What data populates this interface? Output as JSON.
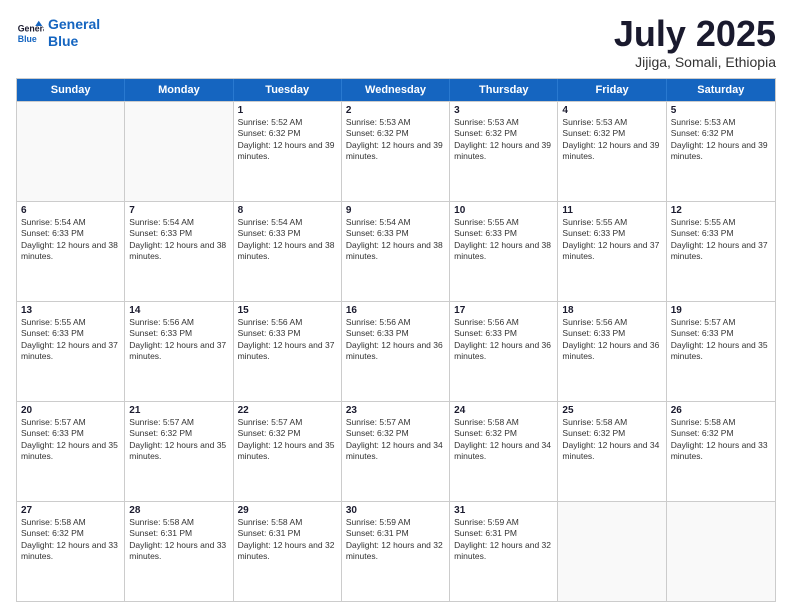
{
  "header": {
    "logo_line1": "General",
    "logo_line2": "Blue",
    "title": "July 2025",
    "location": "Jijiga, Somali, Ethiopia"
  },
  "days_of_week": [
    "Sunday",
    "Monday",
    "Tuesday",
    "Wednesday",
    "Thursday",
    "Friday",
    "Saturday"
  ],
  "weeks": [
    [
      {
        "day": "",
        "info": ""
      },
      {
        "day": "",
        "info": ""
      },
      {
        "day": "1",
        "info": "Sunrise: 5:52 AM\nSunset: 6:32 PM\nDaylight: 12 hours and 39 minutes."
      },
      {
        "day": "2",
        "info": "Sunrise: 5:53 AM\nSunset: 6:32 PM\nDaylight: 12 hours and 39 minutes."
      },
      {
        "day": "3",
        "info": "Sunrise: 5:53 AM\nSunset: 6:32 PM\nDaylight: 12 hours and 39 minutes."
      },
      {
        "day": "4",
        "info": "Sunrise: 5:53 AM\nSunset: 6:32 PM\nDaylight: 12 hours and 39 minutes."
      },
      {
        "day": "5",
        "info": "Sunrise: 5:53 AM\nSunset: 6:32 PM\nDaylight: 12 hours and 39 minutes."
      }
    ],
    [
      {
        "day": "6",
        "info": "Sunrise: 5:54 AM\nSunset: 6:33 PM\nDaylight: 12 hours and 38 minutes."
      },
      {
        "day": "7",
        "info": "Sunrise: 5:54 AM\nSunset: 6:33 PM\nDaylight: 12 hours and 38 minutes."
      },
      {
        "day": "8",
        "info": "Sunrise: 5:54 AM\nSunset: 6:33 PM\nDaylight: 12 hours and 38 minutes."
      },
      {
        "day": "9",
        "info": "Sunrise: 5:54 AM\nSunset: 6:33 PM\nDaylight: 12 hours and 38 minutes."
      },
      {
        "day": "10",
        "info": "Sunrise: 5:55 AM\nSunset: 6:33 PM\nDaylight: 12 hours and 38 minutes."
      },
      {
        "day": "11",
        "info": "Sunrise: 5:55 AM\nSunset: 6:33 PM\nDaylight: 12 hours and 37 minutes."
      },
      {
        "day": "12",
        "info": "Sunrise: 5:55 AM\nSunset: 6:33 PM\nDaylight: 12 hours and 37 minutes."
      }
    ],
    [
      {
        "day": "13",
        "info": "Sunrise: 5:55 AM\nSunset: 6:33 PM\nDaylight: 12 hours and 37 minutes."
      },
      {
        "day": "14",
        "info": "Sunrise: 5:56 AM\nSunset: 6:33 PM\nDaylight: 12 hours and 37 minutes."
      },
      {
        "day": "15",
        "info": "Sunrise: 5:56 AM\nSunset: 6:33 PM\nDaylight: 12 hours and 37 minutes."
      },
      {
        "day": "16",
        "info": "Sunrise: 5:56 AM\nSunset: 6:33 PM\nDaylight: 12 hours and 36 minutes."
      },
      {
        "day": "17",
        "info": "Sunrise: 5:56 AM\nSunset: 6:33 PM\nDaylight: 12 hours and 36 minutes."
      },
      {
        "day": "18",
        "info": "Sunrise: 5:56 AM\nSunset: 6:33 PM\nDaylight: 12 hours and 36 minutes."
      },
      {
        "day": "19",
        "info": "Sunrise: 5:57 AM\nSunset: 6:33 PM\nDaylight: 12 hours and 35 minutes."
      }
    ],
    [
      {
        "day": "20",
        "info": "Sunrise: 5:57 AM\nSunset: 6:33 PM\nDaylight: 12 hours and 35 minutes."
      },
      {
        "day": "21",
        "info": "Sunrise: 5:57 AM\nSunset: 6:32 PM\nDaylight: 12 hours and 35 minutes."
      },
      {
        "day": "22",
        "info": "Sunrise: 5:57 AM\nSunset: 6:32 PM\nDaylight: 12 hours and 35 minutes."
      },
      {
        "day": "23",
        "info": "Sunrise: 5:57 AM\nSunset: 6:32 PM\nDaylight: 12 hours and 34 minutes."
      },
      {
        "day": "24",
        "info": "Sunrise: 5:58 AM\nSunset: 6:32 PM\nDaylight: 12 hours and 34 minutes."
      },
      {
        "day": "25",
        "info": "Sunrise: 5:58 AM\nSunset: 6:32 PM\nDaylight: 12 hours and 34 minutes."
      },
      {
        "day": "26",
        "info": "Sunrise: 5:58 AM\nSunset: 6:32 PM\nDaylight: 12 hours and 33 minutes."
      }
    ],
    [
      {
        "day": "27",
        "info": "Sunrise: 5:58 AM\nSunset: 6:32 PM\nDaylight: 12 hours and 33 minutes."
      },
      {
        "day": "28",
        "info": "Sunrise: 5:58 AM\nSunset: 6:31 PM\nDaylight: 12 hours and 33 minutes."
      },
      {
        "day": "29",
        "info": "Sunrise: 5:58 AM\nSunset: 6:31 PM\nDaylight: 12 hours and 32 minutes."
      },
      {
        "day": "30",
        "info": "Sunrise: 5:59 AM\nSunset: 6:31 PM\nDaylight: 12 hours and 32 minutes."
      },
      {
        "day": "31",
        "info": "Sunrise: 5:59 AM\nSunset: 6:31 PM\nDaylight: 12 hours and 32 minutes."
      },
      {
        "day": "",
        "info": ""
      },
      {
        "day": "",
        "info": ""
      }
    ]
  ]
}
